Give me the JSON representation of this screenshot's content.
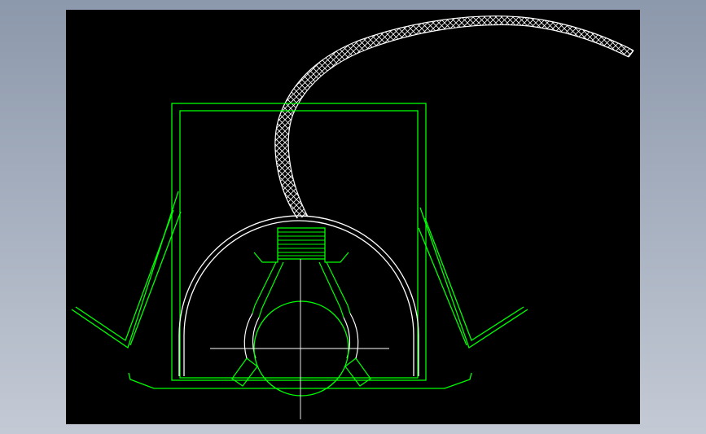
{
  "window": {
    "background_top": "#8c98ab",
    "background_bottom": "#c4cad5"
  },
  "viewport": {
    "background": "#000000"
  },
  "layers": {
    "outline_color": "#00ff00",
    "detail_color": "#ffffff",
    "centerline_color": "#ffffff",
    "hatch_color": "#ffffff"
  }
}
